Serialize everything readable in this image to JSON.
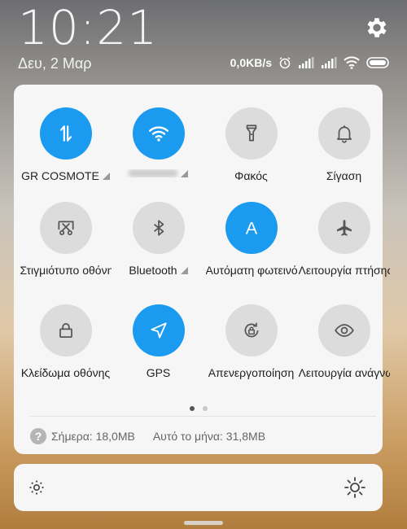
{
  "status": {
    "time": "10:21",
    "date": "Δευ, 2 Μαρ",
    "net_speed": "0,0KB/s"
  },
  "tiles": [
    {
      "id": "data",
      "label": "GR COSMOTE",
      "active": true,
      "icon": "data-transfer-icon",
      "arrow": true
    },
    {
      "id": "wifi",
      "label": "",
      "active": true,
      "icon": "wifi-icon",
      "arrow": true,
      "blurred": true
    },
    {
      "id": "flashlight",
      "label": "Φακός",
      "active": false,
      "icon": "flashlight-icon",
      "arrow": false
    },
    {
      "id": "silent",
      "label": "Σίγαση",
      "active": false,
      "icon": "bell-icon",
      "arrow": false
    },
    {
      "id": "screenshot",
      "label": "Στιγμιότυπο οθόνης",
      "active": false,
      "icon": "screenshot-icon",
      "arrow": false
    },
    {
      "id": "bluetooth",
      "label": "Bluetooth",
      "active": false,
      "icon": "bluetooth-icon",
      "arrow": true
    },
    {
      "id": "autobrightness",
      "label": "Αυτόματη φωτεινότητα",
      "active": true,
      "icon": "auto-brightness-icon",
      "arrow": false
    },
    {
      "id": "airplane",
      "label": "Λειτουργία πτήσης",
      "active": false,
      "icon": "airplane-icon",
      "arrow": false
    },
    {
      "id": "lock",
      "label": "Κλείδωμα οθόνης",
      "active": false,
      "icon": "lock-icon",
      "arrow": false
    },
    {
      "id": "gps",
      "label": "GPS",
      "active": true,
      "icon": "location-icon",
      "arrow": false
    },
    {
      "id": "rotation",
      "label": "Απενεργοποίηση",
      "active": false,
      "icon": "rotation-lock-icon",
      "arrow": false
    },
    {
      "id": "reading",
      "label": "Λειτουργία ανάγνωσης",
      "active": false,
      "icon": "eye-icon",
      "arrow": false
    }
  ],
  "usage": {
    "today": "Σήμερα: 18,0MB",
    "month": "Αυτό το μήνα: 31,8MB"
  },
  "brightness": {
    "level": 0.0
  },
  "colors": {
    "accent": "#1a9bf0",
    "inactive": "#dcdcdc"
  }
}
